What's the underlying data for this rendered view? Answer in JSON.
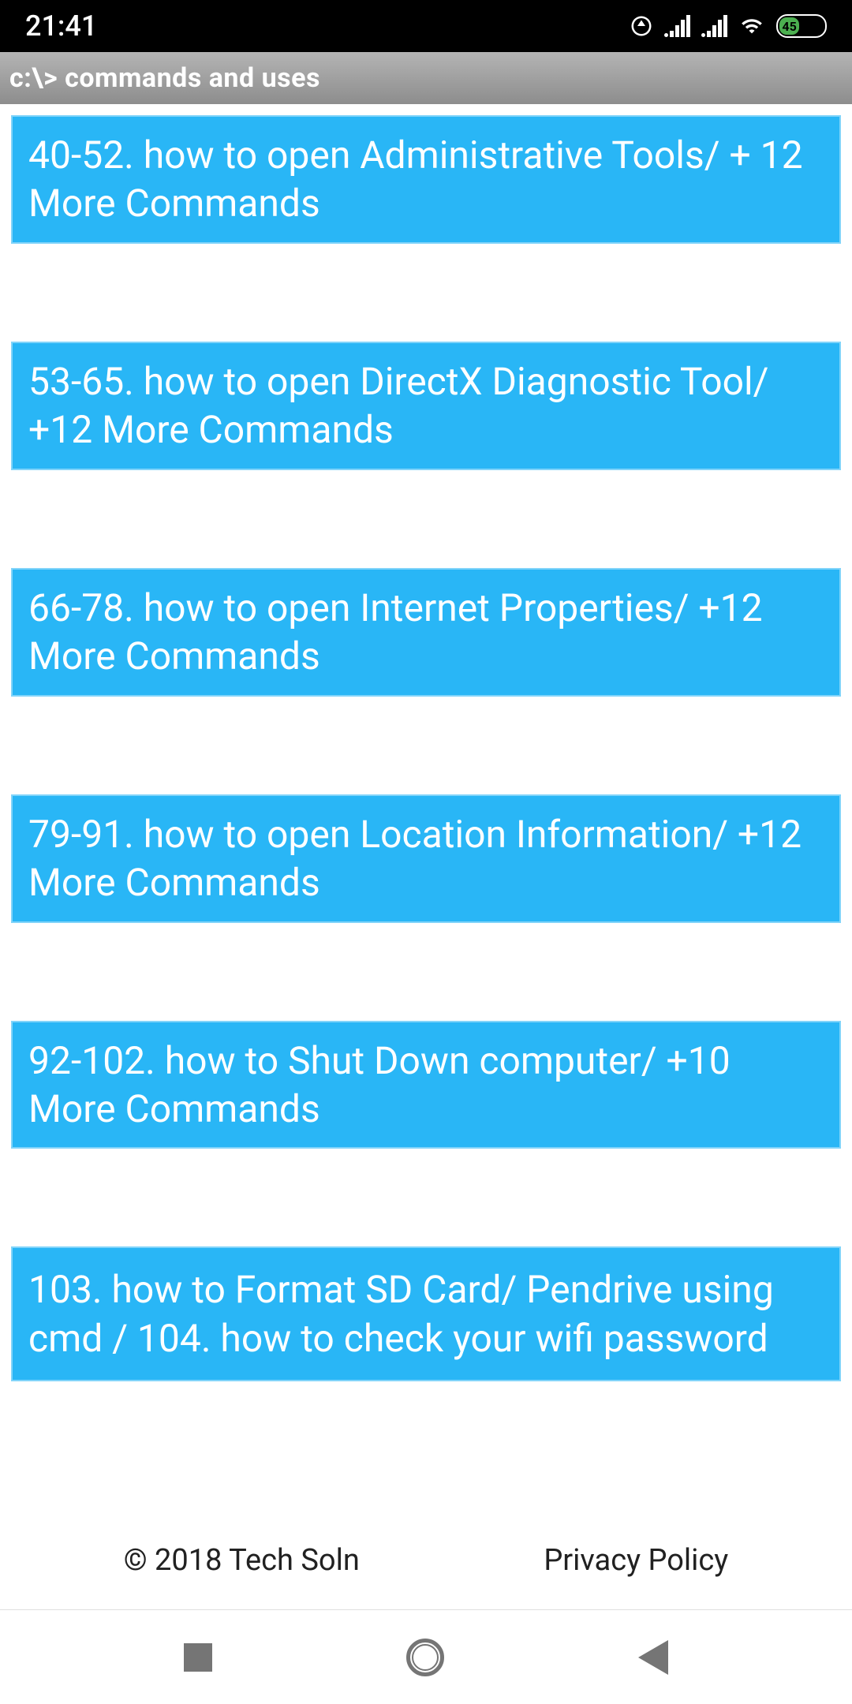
{
  "status": {
    "time": "21:41",
    "battery_percent": "45"
  },
  "app_bar": {
    "title": "c:\\> commands and uses"
  },
  "list": {
    "items": [
      "40-52. how to open Administrative Tools/ + 12 More Commands",
      "53-65. how to open DirectX Diagnostic Tool/ +12 More Commands",
      "66-78. how to open Internet Properties/ +12 More Commands",
      "79-91. how to open Location Information/ +12 More Commands",
      "92-102. how to Shut Down computer/ +10 More Commands",
      "103. how to Format SD Card/ Pendrive using cmd / 104. how to check your wifi password"
    ]
  },
  "footer": {
    "copyright": "© 2018 Tech Soln",
    "privacy": "Privacy Policy"
  }
}
